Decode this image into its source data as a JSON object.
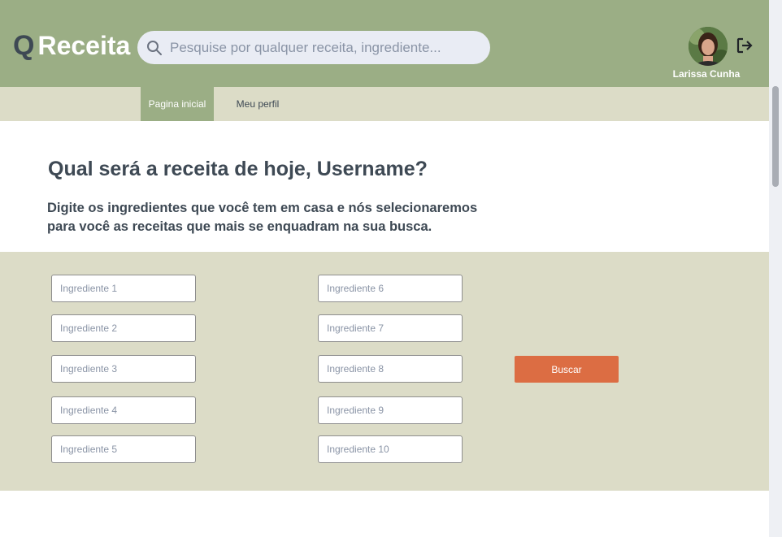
{
  "header": {
    "logo_q": "Q",
    "logo_text": "Receita",
    "search_placeholder": "Pesquise por qualquer receita, ingrediente...",
    "user_name": "Larissa Cunha"
  },
  "nav": {
    "tabs": [
      {
        "label": "Pagina inicial",
        "active": true
      },
      {
        "label": "Meu perfil",
        "active": false
      }
    ]
  },
  "hero": {
    "headline": "Qual será a receita de hoje, Username?",
    "subtext": "Digite os ingredientes que você tem em casa e nós selecionaremos para você as receitas que mais se enquadram na sua busca."
  },
  "ingredients": {
    "placeholders": [
      "Ingrediente 1",
      "Ingrediente 2",
      "Ingrediente 3",
      "Ingrediente 4",
      "Ingrediente 5",
      "Ingrediente 6",
      "Ingrediente 7",
      "Ingrediente 8",
      "Ingrediente 9",
      "Ingrediente 10"
    ],
    "search_button": "Buscar"
  },
  "colors": {
    "header_green": "#9bae85",
    "beige": "#dcdcc7",
    "accent_orange": "#dc6d43",
    "text_dark": "#3e4954"
  },
  "icons": {
    "search": "search-icon",
    "logout": "logout-icon",
    "avatar": "avatar"
  }
}
